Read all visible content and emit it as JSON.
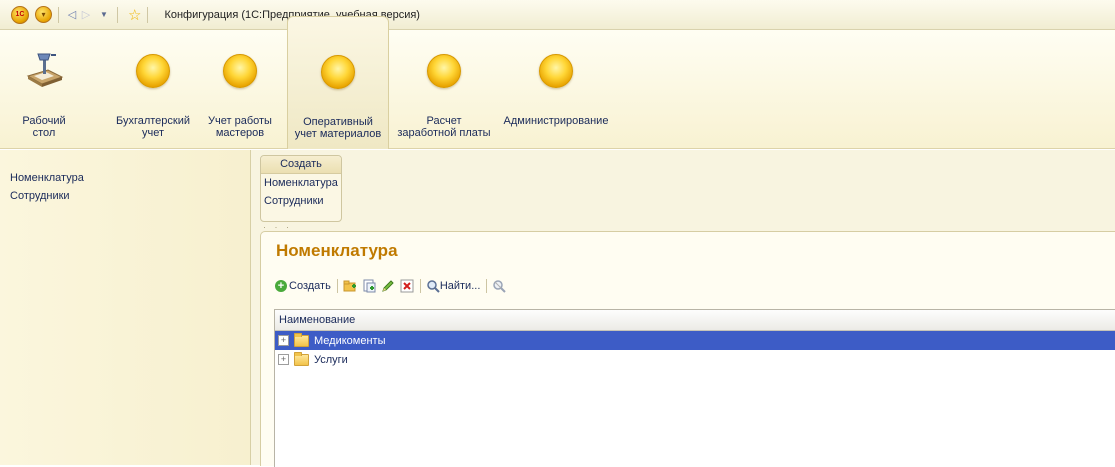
{
  "window": {
    "title": "Конфигурация (1С:Предприятие, учебная версия)",
    "logo_text": "1С"
  },
  "titlebar": {
    "menu_glyph": "▾",
    "back_glyph": "◁",
    "forward_glyph": "▷",
    "history_glyph": "▼",
    "favorite_glyph": "☆"
  },
  "sections": [
    {
      "label": "Рабочий\nстол",
      "icon": "desk-lamp-icon"
    },
    {
      "label": "Бухгалтерский\nучет",
      "icon": "orb-icon"
    },
    {
      "label": "Учет работы\nмастеров",
      "icon": "orb-icon"
    },
    {
      "label": "Оперативный\nучет материалов",
      "icon": "orb-icon",
      "active": true
    },
    {
      "label": "Расчет\nзаработной платы",
      "icon": "orb-icon"
    },
    {
      "label": "Администрирование",
      "icon": "orb-icon"
    }
  ],
  "left_nav": {
    "items": [
      "Номенклатура",
      "Сотрудники"
    ]
  },
  "actions_panel": {
    "title": "Создать",
    "items": [
      "Номенклатура",
      "Сотрудники"
    ],
    "splitter": "· · ·"
  },
  "form": {
    "title": "Номенклатура",
    "toolbar": {
      "create_label": "Создать",
      "find_label": "Найти..."
    },
    "grid": {
      "column": "Наименование",
      "rows": [
        {
          "name": "Медикоменты",
          "selected": true
        },
        {
          "name": "Услуги",
          "selected": false
        }
      ]
    }
  },
  "colors": {
    "accent_title": "#c07a00",
    "selection": "#3d5cc6",
    "panel": "#f8f2d2"
  }
}
